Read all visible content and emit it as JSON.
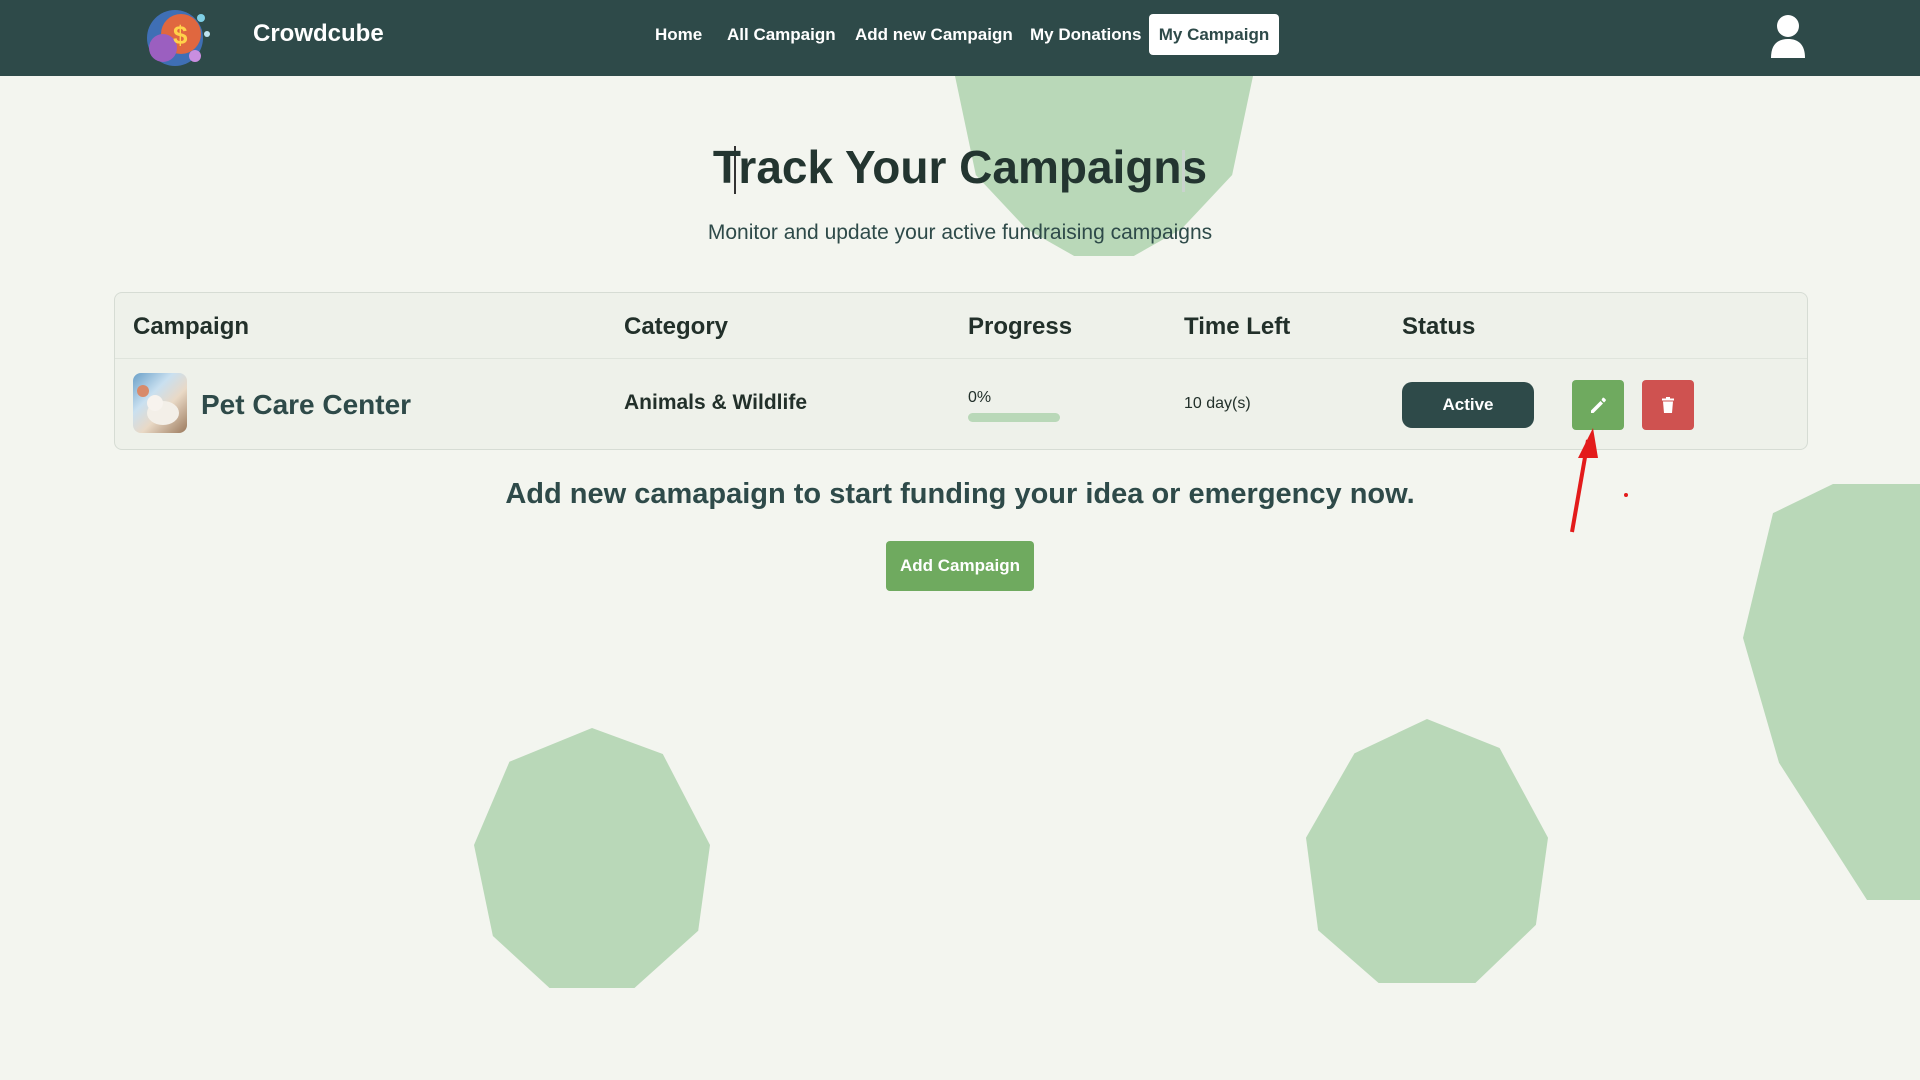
{
  "brand": {
    "name": "Crowdcube"
  },
  "nav": {
    "links": [
      "Home",
      "All Campaign",
      "Add new Campaign",
      "My Donations"
    ],
    "active": "My Campaign"
  },
  "hero": {
    "title": "Track Your Campaigns",
    "subtitle": "Monitor and update your active fundraising campaigns"
  },
  "table": {
    "headers": [
      "Campaign",
      "Category",
      "Progress",
      "Time Left",
      "Status"
    ],
    "rows": [
      {
        "name": "Pet Care Center",
        "category": "Animals & Wildlife",
        "progress_label": "0%",
        "progress_value": 0,
        "time_left": "10 day(s)",
        "status": "Active"
      }
    ]
  },
  "cta": {
    "text": "Add new camapaign to start funding your idea or emergency now.",
    "button": "Add Campaign"
  },
  "icons": {
    "logo": "crowdfunding-logo-icon",
    "user": "user-icon",
    "edit": "pencil-icon",
    "delete": "trash-icon"
  },
  "colors": {
    "navbar": "#2e4a49",
    "accent_green": "#6faa5f",
    "danger": "#cf5250",
    "decor": "#b9d8b8",
    "background": "#f3f5ef"
  }
}
